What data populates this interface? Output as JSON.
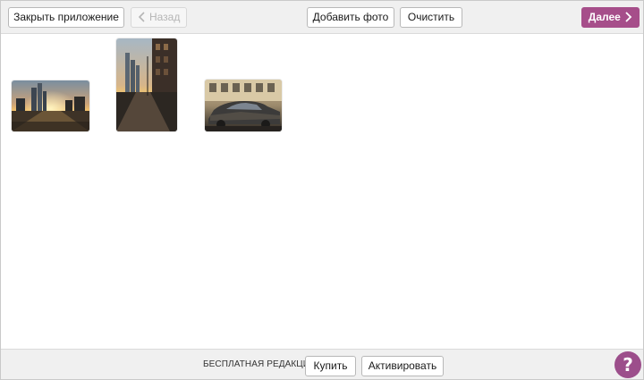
{
  "toolbar": {
    "close_label": "Закрыть приложение",
    "back_label": "Назад",
    "add_photo_label": "Добавить фото",
    "clear_label": "Очистить",
    "next_label": "Далее"
  },
  "photos": [
    {
      "kind": "sunset-city-skyline",
      "orientation": "landscape"
    },
    {
      "kind": "sunset-street-towers",
      "orientation": "portrait"
    },
    {
      "kind": "parked-car-street",
      "orientation": "landscape"
    }
  ],
  "footer": {
    "edition_label": "БЕСПЛАТНАЯ РЕДАКЦИЯ",
    "buy_label": "Купить",
    "activate_label": "Активировать",
    "help_symbol": "?"
  },
  "colors": {
    "accent": "#a64e8a",
    "help": "#9c4e8b",
    "toolbar_bg": "#f0f0f0"
  }
}
